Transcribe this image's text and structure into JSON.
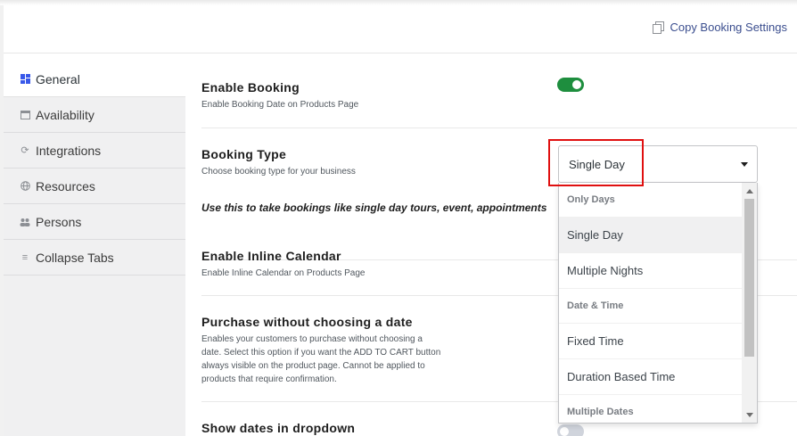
{
  "header": {
    "copy_label": "Copy Booking Settings"
  },
  "sidebar": {
    "items": [
      {
        "label": "General",
        "icon": "grid-icon",
        "active": true
      },
      {
        "label": "Availability",
        "icon": "calendar-icon",
        "active": false
      },
      {
        "label": "Integrations",
        "icon": "sync-icon",
        "active": false
      },
      {
        "label": "Resources",
        "icon": "globe-icon",
        "active": false
      },
      {
        "label": "Persons",
        "icon": "people-icon",
        "active": false
      },
      {
        "label": "Collapse Tabs",
        "icon": "list-icon",
        "active": false
      }
    ]
  },
  "settings": {
    "enable_booking": {
      "title": "Enable Booking",
      "desc": "Enable Booking Date on Products Page",
      "enabled": true
    },
    "booking_type": {
      "title": "Booking Type",
      "desc": "Choose booking type for your business",
      "note": "Use this to take bookings like single day tours, event, appointments",
      "selected": "Single Day"
    },
    "inline_calendar": {
      "title": "Enable Inline Calendar",
      "desc": "Enable Inline Calendar on Products Page"
    },
    "purchase_without_date": {
      "title": "Purchase without choosing a date",
      "desc_1": "Enables your customers to purchase without choosing a",
      "desc_2": "date. Select this option if you want the ADD TO CART button",
      "desc_3": "always visible on the product page. Cannot be applied to",
      "desc_4": "products that require confirmation."
    },
    "dates_dropdown": {
      "title": "Show dates in dropdown"
    }
  },
  "dropdown": {
    "options": [
      {
        "label": "Only Days",
        "type": "group"
      },
      {
        "label": "Single Day",
        "type": "option",
        "selected": true
      },
      {
        "label": "Multiple Nights",
        "type": "option"
      },
      {
        "label": "Date & Time",
        "type": "group"
      },
      {
        "label": "Fixed Time",
        "type": "option"
      },
      {
        "label": "Duration Based Time",
        "type": "option"
      },
      {
        "label": "Multiple Dates",
        "type": "group"
      }
    ]
  },
  "colors": {
    "toggle_on": "#1e8e3e",
    "highlight_box": "#e01010",
    "active_nav_icon": "#3858e9"
  }
}
